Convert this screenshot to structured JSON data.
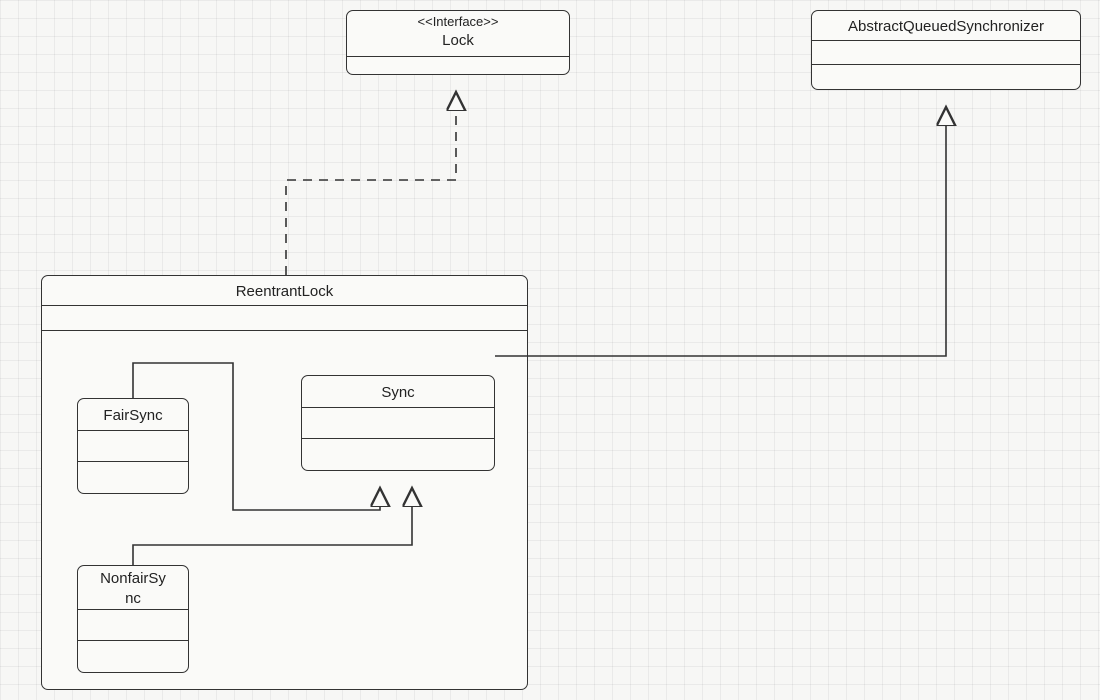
{
  "diagram": {
    "lock": {
      "stereotype": "<<Interface>>",
      "name": "Lock"
    },
    "aqs": {
      "name": "AbstractQueuedSynchronizer"
    },
    "reentrant": {
      "name": "ReentrantLock"
    },
    "sync": {
      "name": "Sync"
    },
    "fair": {
      "name": "FairSync"
    },
    "nonfair_line1": "NonfairSy",
    "nonfair_line2": "nc"
  },
  "relations": [
    {
      "from": "ReentrantLock",
      "to": "Lock",
      "kind": "realization"
    },
    {
      "from": "Sync",
      "to": "AbstractQueuedSynchronizer",
      "kind": "generalization"
    },
    {
      "from": "FairSync",
      "to": "Sync",
      "kind": "generalization"
    },
    {
      "from": "NonfairSync",
      "to": "Sync",
      "kind": "generalization"
    }
  ]
}
